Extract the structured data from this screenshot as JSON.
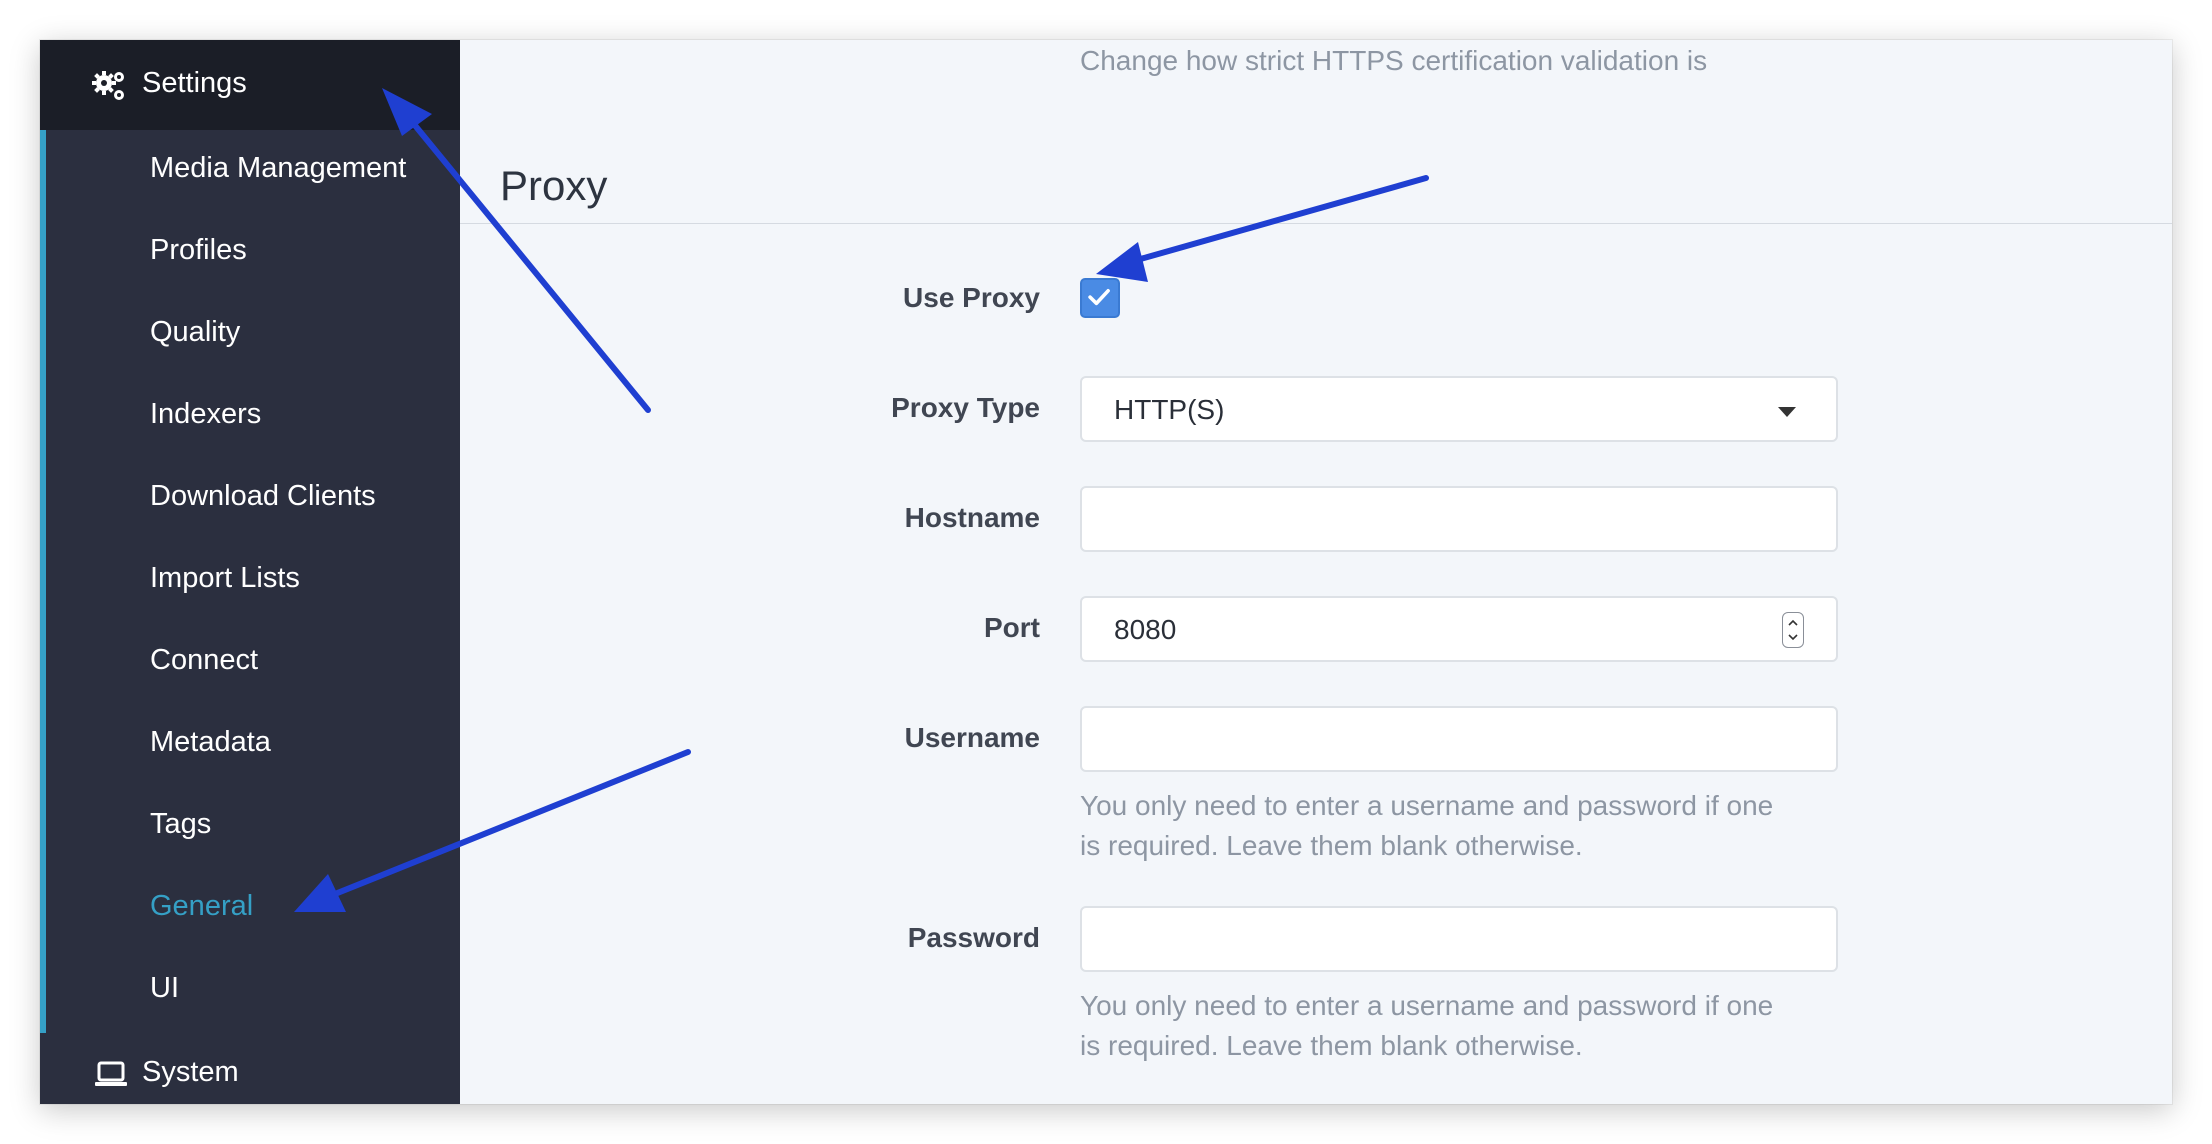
{
  "sidebar": {
    "settings_label": "Settings",
    "items": [
      {
        "label": "Media Management"
      },
      {
        "label": "Profiles"
      },
      {
        "label": "Quality"
      },
      {
        "label": "Indexers"
      },
      {
        "label": "Download Clients"
      },
      {
        "label": "Import Lists"
      },
      {
        "label": "Connect"
      },
      {
        "label": "Metadata"
      },
      {
        "label": "Tags"
      },
      {
        "label": "General",
        "active": true
      },
      {
        "label": "UI"
      }
    ],
    "system_label": "System"
  },
  "main": {
    "top_help": "Change how strict HTTPS certification validation is",
    "section_title": "Proxy",
    "use_proxy": {
      "label": "Use Proxy",
      "checked": true
    },
    "proxy_type": {
      "label": "Proxy Type",
      "value": "HTTP(S)"
    },
    "hostname": {
      "label": "Hostname",
      "value": ""
    },
    "port": {
      "label": "Port",
      "value": "8080"
    },
    "username": {
      "label": "Username",
      "value": "",
      "help_line1": "You only need to enter a username and password if one",
      "help_line2": "is required. Leave them blank otherwise."
    },
    "password": {
      "label": "Password",
      "value": "",
      "help_line1": "You only need to enter a username and password if one",
      "help_line2": "is required. Leave them blank otherwise."
    }
  },
  "colors": {
    "sidebar_bg": "#2b2f3f",
    "sidebar_header_bg": "#1b1e27",
    "accent": "#35a0c6",
    "checkbox": "#4a8be4",
    "annotation_arrow": "#1f3fd1"
  },
  "icons": {
    "settings": "gears-icon",
    "system": "laptop-icon",
    "checkmark": "check-icon",
    "dropdown": "caret-down-icon",
    "spinner": "spinner-arrows-icon"
  }
}
